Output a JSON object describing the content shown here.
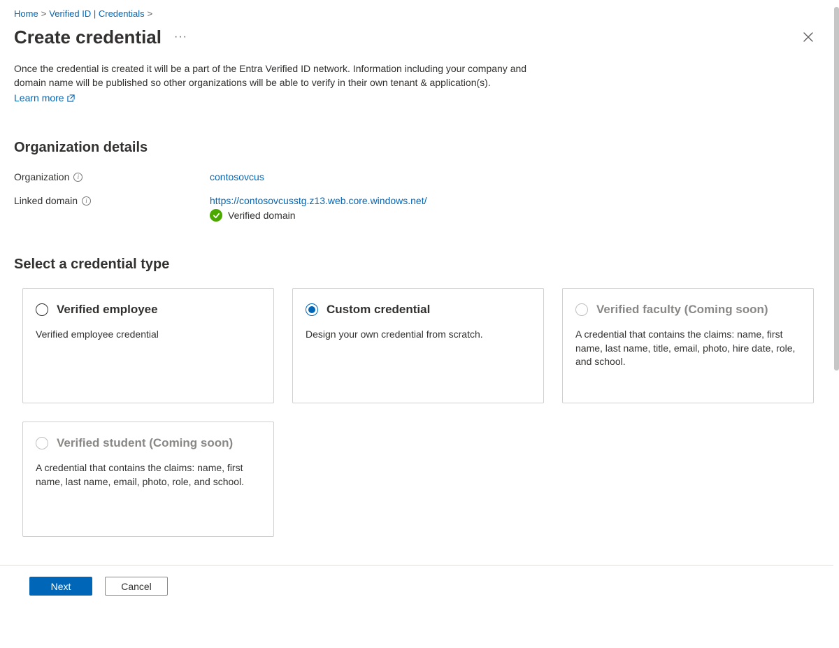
{
  "breadcrumb": {
    "items": [
      {
        "label": "Home"
      },
      {
        "label": "Verified ID | Credentials"
      }
    ]
  },
  "header": {
    "title": "Create credential"
  },
  "intro": {
    "text": "Once the credential is created it will be a part of the Entra Verified ID network. Information including your company and domain name will be published so other organizations will be able to verify in their own tenant & application(s).",
    "learn_more_label": "Learn more"
  },
  "org_section": {
    "heading": "Organization details",
    "org_label": "Organization",
    "org_value": "contosovcus",
    "domain_label": "Linked domain",
    "domain_value": "https://contosovcusstg.z13.web.core.windows.net/",
    "verified_label": "Verified domain"
  },
  "type_section": {
    "heading": "Select a credential type",
    "cards": [
      {
        "title": "Verified employee",
        "desc": "Verified employee credential",
        "selected": false,
        "disabled": false
      },
      {
        "title": "Custom credential",
        "desc": "Design your own credential from scratch.",
        "selected": true,
        "disabled": false
      },
      {
        "title": "Verified faculty (Coming soon)",
        "desc": "A credential that contains the claims: name, first name, last name, title, email, photo, hire date, role, and school.",
        "selected": false,
        "disabled": true
      },
      {
        "title": "Verified student (Coming soon)",
        "desc": "A credential that contains the claims: name, first name, last name, email, photo, role, and school.",
        "selected": false,
        "disabled": true
      }
    ]
  },
  "footer": {
    "next": "Next",
    "cancel": "Cancel"
  }
}
